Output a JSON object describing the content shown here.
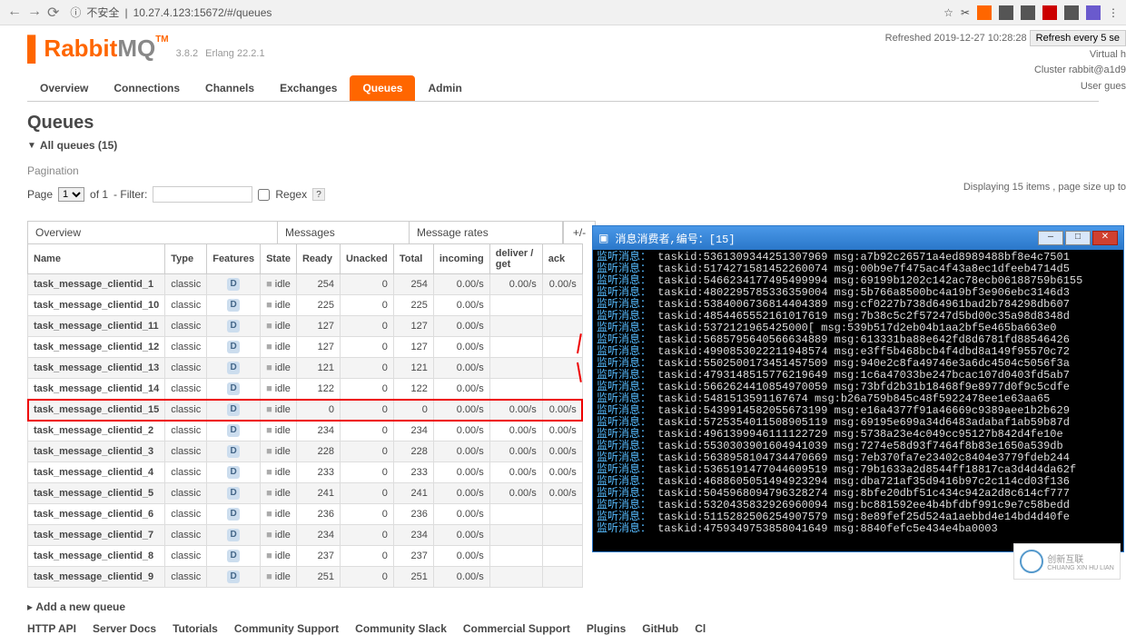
{
  "browser": {
    "insecure_label": "不安全",
    "url": "10.27.4.123:15672/#/queues"
  },
  "header": {
    "logo_main": "Rabbit",
    "logo_sub": "MQ",
    "tm": "TM",
    "version": "3.8.2",
    "erlang": "Erlang 22.2.1",
    "refreshed": "Refreshed 2019-12-27 10:28:28",
    "refresh_button": "Refresh every 5 se",
    "virtual": "Virtual h",
    "cluster_label": "Cluster",
    "cluster_value": "rabbit@a1d9",
    "user_label": "User",
    "user_value": "gues"
  },
  "tabs": [
    "Overview",
    "Connections",
    "Channels",
    "Exchanges",
    "Queues",
    "Admin"
  ],
  "active_tab": "Queues",
  "title": "Queues",
  "filter": {
    "expand": "▼",
    "label": "All queues (15)",
    "pagination": "Pagination",
    "page_label": "Page",
    "page_value": "1",
    "of_label": "of 1",
    "filter_label": "- Filter:",
    "filter_value": "",
    "regex_label": "Regex",
    "help": "?",
    "count": "Displaying 15 items , page size up to"
  },
  "grp": {
    "overview": "Overview",
    "messages": "Messages",
    "rates": "Message rates",
    "plus": "+/-"
  },
  "cols": {
    "name": "Name",
    "type": "Type",
    "features": "Features",
    "state": "State",
    "ready": "Ready",
    "unacked": "Unacked",
    "total": "Total",
    "incoming": "incoming",
    "deliver_get": "deliver / get",
    "ack": "ack"
  },
  "state_value": "idle",
  "type_value": "classic",
  "feature_badge": "D",
  "rows": [
    {
      "name": "task_message_clientid_1",
      "ready": 254,
      "unacked": 0,
      "total": 254,
      "incoming": "0.00/s",
      "dg": "0.00/s",
      "ack": "0.00/s"
    },
    {
      "name": "task_message_clientid_10",
      "ready": 225,
      "unacked": 0,
      "total": 225,
      "incoming": "0.00/s",
      "dg": "",
      "ack": ""
    },
    {
      "name": "task_message_clientid_11",
      "ready": 127,
      "unacked": 0,
      "total": 127,
      "incoming": "0.00/s",
      "dg": "",
      "ack": ""
    },
    {
      "name": "task_message_clientid_12",
      "ready": 127,
      "unacked": 0,
      "total": 127,
      "incoming": "0.00/s",
      "dg": "",
      "ack": ""
    },
    {
      "name": "task_message_clientid_13",
      "ready": 121,
      "unacked": 0,
      "total": 121,
      "incoming": "0.00/s",
      "dg": "",
      "ack": ""
    },
    {
      "name": "task_message_clientid_14",
      "ready": 122,
      "unacked": 0,
      "total": 122,
      "incoming": "0.00/s",
      "dg": "",
      "ack": ""
    },
    {
      "name": "task_message_clientid_15",
      "ready": 0,
      "unacked": 0,
      "total": 0,
      "incoming": "0.00/s",
      "dg": "0.00/s",
      "ack": "0.00/s",
      "highlight": true
    },
    {
      "name": "task_message_clientid_2",
      "ready": 234,
      "unacked": 0,
      "total": 234,
      "incoming": "0.00/s",
      "dg": "0.00/s",
      "ack": "0.00/s"
    },
    {
      "name": "task_message_clientid_3",
      "ready": 228,
      "unacked": 0,
      "total": 228,
      "incoming": "0.00/s",
      "dg": "0.00/s",
      "ack": "0.00/s"
    },
    {
      "name": "task_message_clientid_4",
      "ready": 233,
      "unacked": 0,
      "total": 233,
      "incoming": "0.00/s",
      "dg": "0.00/s",
      "ack": "0.00/s"
    },
    {
      "name": "task_message_clientid_5",
      "ready": 241,
      "unacked": 0,
      "total": 241,
      "incoming": "0.00/s",
      "dg": "0.00/s",
      "ack": "0.00/s"
    },
    {
      "name": "task_message_clientid_6",
      "ready": 236,
      "unacked": 0,
      "total": 236,
      "incoming": "0.00/s",
      "dg": "",
      "ack": ""
    },
    {
      "name": "task_message_clientid_7",
      "ready": 234,
      "unacked": 0,
      "total": 234,
      "incoming": "0.00/s",
      "dg": "",
      "ack": ""
    },
    {
      "name": "task_message_clientid_8",
      "ready": 237,
      "unacked": 0,
      "total": 237,
      "incoming": "0.00/s",
      "dg": "",
      "ack": ""
    },
    {
      "name": "task_message_clientid_9",
      "ready": 251,
      "unacked": 0,
      "total": 251,
      "incoming": "0.00/s",
      "dg": "",
      "ack": ""
    }
  ],
  "add_queue": "Add a new queue",
  "footer": [
    "HTTP API",
    "Server Docs",
    "Tutorials",
    "Community Support",
    "Community Slack",
    "Commercial Support",
    "Plugins",
    "GitHub",
    "Cl"
  ],
  "console": {
    "title": "消息消费者,编号：[15]",
    "prefix": "监听消息：",
    "lines": [
      {
        "t": "taskid:5361309344251307969",
        "m": "msg:a7b92c26571a4ed8989488bf8e4c7501"
      },
      {
        "t": "taskid:5174271581452260074",
        "m": "msg:00b9e7f475ac4f43a8ec1dfeeb4714d5"
      },
      {
        "t": "taskid:5466234177495499994",
        "m": "msg:69199b1202c142ac78ecb06188759b6155"
      },
      {
        "t": "taskid:4802295785336359004",
        "m": "msg:5b766a8500bc4a19bf3e906ebc3146d3"
      },
      {
        "t": "taskid:5384006736814404389",
        "m": "msg:cf0227b738d64961bad2b784298db607"
      },
      {
        "t": "taskid:4854465552161017619",
        "m": "msg:7b38c5c2f57247d5bd00c35a98d8348d"
      },
      {
        "t": "taskid:5372121965425000[",
        "m": "msg:539b517d2eb04b1aa2bf5e465ba663e0"
      },
      {
        "t": "taskid:5685795640566634889",
        "m": "msg:613331ba88e642fd8d6781fd88546426"
      },
      {
        "t": "taskid:4990853022211948574",
        "m": "msg:e3ff5b468bcb4f4dbd8a149f95570c72"
      },
      {
        "t": "taskid:5502500173451457509",
        "m": "msg:940e2c8fa49746e3a6dc4504c5056f3a"
      },
      {
        "t": "taskid:4793148515776219649",
        "m": "msg:1c6a47033be247bcac107d0403fd5ab7"
      },
      {
        "t": "taskid:5662624410854970059",
        "m": "msg:73bfd2b31b18468f9e8977d0f9c5cdfe"
      },
      {
        "t": "taskid:5481513591167674",
        "m": "msg:b26a759b845c48f5922478ee1e63aa65"
      },
      {
        "t": "taskid:5439914582055673199",
        "m": "msg:e16a4377f91a46669c9389aee1b2b629"
      },
      {
        "t": "taskid:5725354011508905119",
        "m": "msg:69195e699a34d6483adabaf1ab59b87d"
      },
      {
        "t": "taskid:4961399946111122729",
        "m": "msg:5738a23e4c049cc95127b842d4fe10e"
      },
      {
        "t": "taskid:5530303901604941039",
        "m": "msg:7274e58d93f7464f8b83e1650a539db"
      },
      {
        "t": "taskid:5638958104734470669",
        "m": "msg:7eb370fa7e23402c8404e3779fdeb244"
      },
      {
        "t": "taskid:5365191477044609519",
        "m": "msg:79b1633a2d8544ff18817ca3d4d4da62f"
      },
      {
        "t": "taskid:4688605051494923294",
        "m": "msg:dba721af35d9416b97c2c114cd03f136"
      },
      {
        "t": "taskid:5045968094796328274",
        "m": "msg:8bfe20dbf51c434c942a2d8c614cf777"
      },
      {
        "t": "taskid:5320435832926960094",
        "m": "msg:bc881592ee4b4bfdbf991c9e7c58bedd"
      },
      {
        "t": "taskid:5115282506254907579",
        "m": "msg:8e89fef25d524a1aebbd4e14bd4d40fe"
      },
      {
        "t": "taskid:4759349753858041649",
        "m": "msg:8840fefc5e434e4ba0003"
      }
    ]
  },
  "watermark": "创新互联"
}
